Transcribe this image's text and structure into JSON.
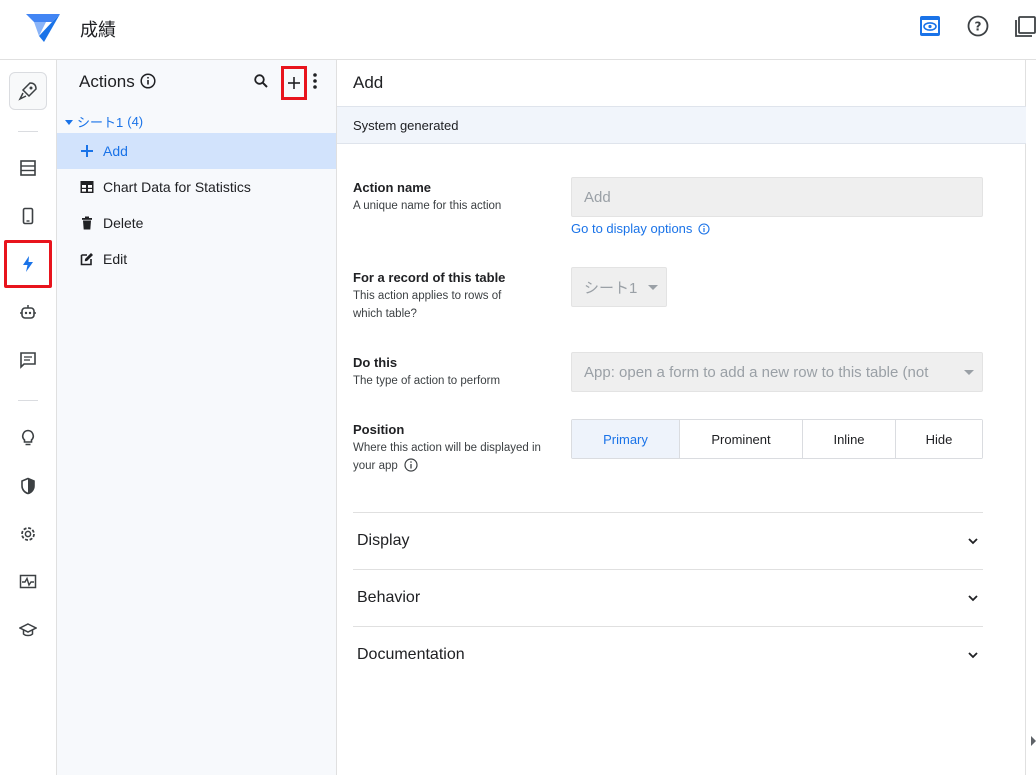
{
  "app": {
    "title": "成績"
  },
  "panel": {
    "title": "Actions",
    "group": {
      "label": "シート1",
      "count": "(4)"
    },
    "items": [
      {
        "label": "Add",
        "icon": "plus-icon",
        "selected": true
      },
      {
        "label": "Chart Data for Statistics",
        "icon": "table-icon",
        "selected": false
      },
      {
        "label": "Delete",
        "icon": "trash-icon",
        "selected": false
      },
      {
        "label": "Edit",
        "icon": "edit-icon",
        "selected": false
      }
    ]
  },
  "main": {
    "title": "Add",
    "section_header": "System generated",
    "fields": {
      "action_name": {
        "label": "Action name",
        "help": "A unique name for this action",
        "value": "Add",
        "link": "Go to display options"
      },
      "table": {
        "label": "For a record of this table",
        "help": "This action applies to rows of which table?",
        "value": "シート1"
      },
      "do_this": {
        "label": "Do this",
        "help": "The type of action to perform",
        "value": "App: open a form to add a new row to this table (not"
      },
      "position": {
        "label": "Position",
        "help": "Where this action will be displayed in your app",
        "options": [
          "Primary",
          "Prominent",
          "Inline",
          "Hide"
        ],
        "selected": "Primary"
      }
    },
    "sections": [
      "Display",
      "Behavior",
      "Documentation"
    ]
  },
  "colors": {
    "accent": "#1a73e8",
    "highlight": "#e8141d",
    "selected_bg": "#d2e3fc"
  }
}
